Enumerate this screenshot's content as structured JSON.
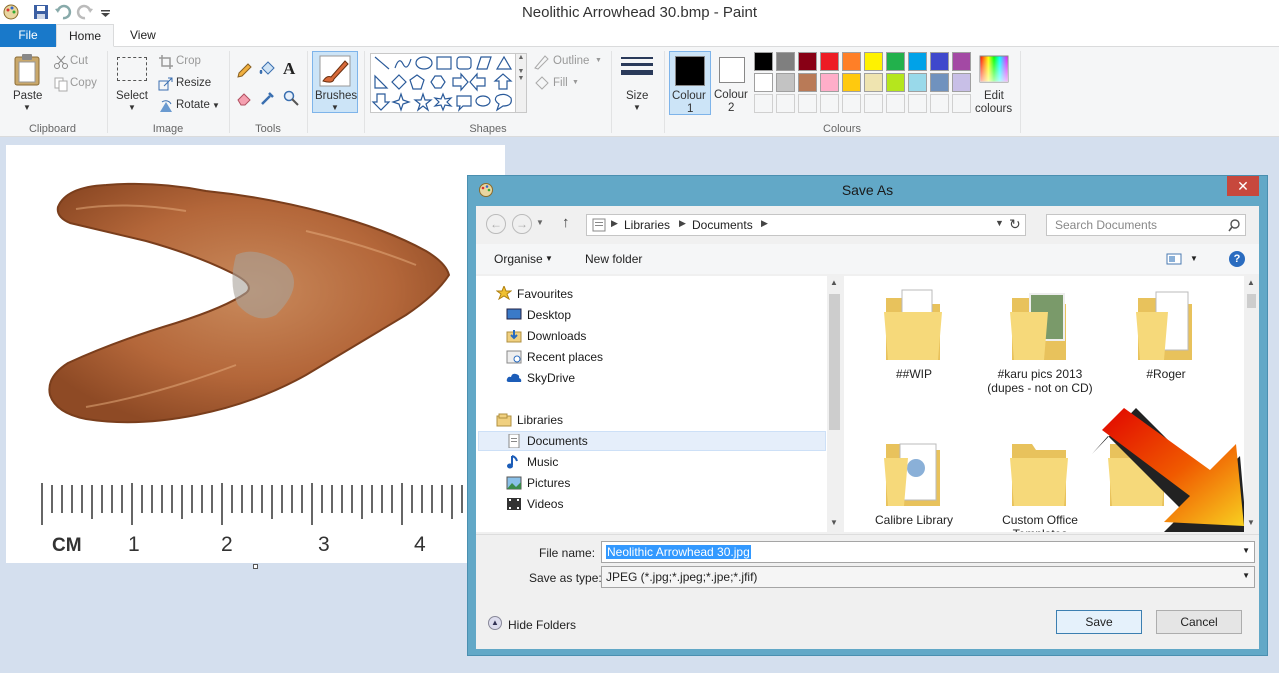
{
  "window": {
    "title": "Neolithic Arrowhead 30.bmp - Paint"
  },
  "tabs": [
    {
      "label": "File"
    },
    {
      "label": "Home"
    },
    {
      "label": "View"
    }
  ],
  "ribbon": {
    "clipboard": {
      "paste": "Paste",
      "cut": "Cut",
      "copy": "Copy",
      "label": "Clipboard"
    },
    "image": {
      "select": "Select",
      "crop": "Crop",
      "resize": "Resize",
      "rotate": "Rotate",
      "label": "Image"
    },
    "tools": {
      "label": "Tools",
      "text_tool": "A"
    },
    "brushes": {
      "label": "Brushes"
    },
    "shapes": {
      "outline": "Outline",
      "fill": "Fill",
      "label": "Shapes"
    },
    "size": {
      "label": "Size"
    },
    "colours": {
      "colour1": "Colour",
      "colour1_n": "1",
      "colour2": "Colour",
      "colour2_n": "2",
      "edit": "Edit",
      "edit2": "colours",
      "label": "Colours",
      "row1": [
        "#000000",
        "#7f7f7f",
        "#880015",
        "#ed1c24",
        "#ff7f27",
        "#fff200",
        "#22b14c",
        "#00a2e8",
        "#3f48cc",
        "#a349a4"
      ],
      "row2": [
        "#ffffff",
        "#c3c3c3",
        "#b97a57",
        "#ffaec9",
        "#ffc90e",
        "#efe4b0",
        "#b5e61d",
        "#99d9ea",
        "#7092be",
        "#c8bfe7"
      ]
    }
  },
  "canvas": {
    "ruler_labels": [
      "CM",
      "1",
      "2",
      "3",
      "4"
    ]
  },
  "dialog": {
    "title": "Save As",
    "close": "✕",
    "breadcrumb": [
      "Libraries",
      "Documents"
    ],
    "search_placeholder": "Search Documents",
    "organise": "Organise",
    "new_folder": "New folder",
    "nav": {
      "favourites": "Favourites",
      "desktop": "Desktop",
      "downloads": "Downloads",
      "recent": "Recent places",
      "skydrive": "SkyDrive",
      "libraries": "Libraries",
      "documents": "Documents",
      "music": "Music",
      "pictures": "Pictures",
      "videos": "Videos"
    },
    "folders": [
      {
        "name": "##WIP"
      },
      {
        "name": "#karu pics 2013 (dupes - not on CD)"
      },
      {
        "name": "#Roger"
      },
      {
        "name": "Calibre Library"
      },
      {
        "name": "Custom Office Templates"
      }
    ],
    "file_name_label": "File name:",
    "file_name_value": "Neolithic Arrowhead 30.jpg",
    "type_label": "Save as type:",
    "type_value": "JPEG (*.jpg;*.jpeg;*.jpe;*.jfif)",
    "hide_folders": "Hide Folders",
    "save": "Save",
    "cancel": "Cancel"
  }
}
